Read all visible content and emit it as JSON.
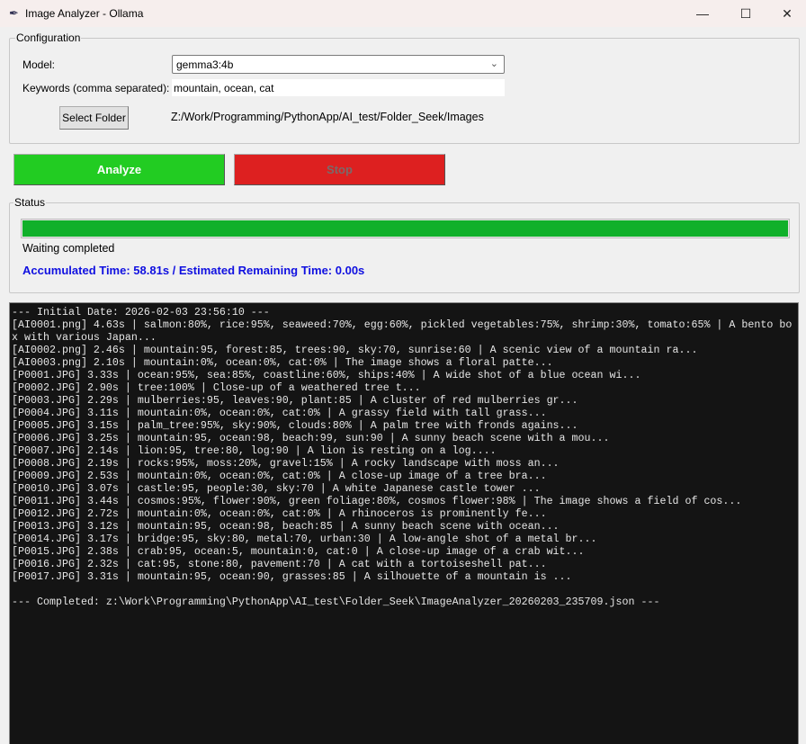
{
  "window": {
    "title": "Image Analyzer - Ollama",
    "minimize": "—",
    "maximize": "☐",
    "close": "✕"
  },
  "config": {
    "legend": "Configuration",
    "model_label": "Model:",
    "model_value": "gemma3:4b",
    "keywords_label": "Keywords (comma separated):",
    "keywords_value": "mountain, ocean, cat",
    "select_folder_label": "Select Folder",
    "folder_path": "Z:/Work/Programming/PythonApp/AI_test/Folder_Seek/Images"
  },
  "actions": {
    "analyze_label": "Analyze",
    "stop_label": "Stop"
  },
  "status": {
    "legend": "Status",
    "progress_percent": 100,
    "message": "Waiting completed",
    "time_text": "Accumulated Time: 58.81s / Estimated Remaining Time: 0.00s"
  },
  "colors": {
    "analyze": "#22cc22",
    "stop": "#dd2020",
    "progress": "#10b02a",
    "time_text": "#1010e0",
    "log_bg": "#141414"
  },
  "log": [
    "--- Initial Date: 2026-02-03 23:56:10 ---",
    "[AI0001.png] 4.63s | salmon:80%, rice:95%, seaweed:70%, egg:60%, pickled vegetables:75%, shrimp:30%, tomato:65% | A bento box with various Japan...",
    "[AI0002.png] 2.46s | mountain:95, forest:85, trees:90, sky:70, sunrise:60 | A scenic view of a mountain ra...",
    "[AI0003.png] 2.10s | mountain:0%, ocean:0%, cat:0% | The image shows a floral patte...",
    "[P0001.JPG] 3.33s | ocean:95%, sea:85%, coastline:60%, ships:40% | A wide shot of a blue ocean wi...",
    "[P0002.JPG] 2.90s | tree:100% | Close-up of a weathered tree t...",
    "[P0003.JPG] 2.29s | mulberries:95, leaves:90, plant:85 | A cluster of red mulberries gr...",
    "[P0004.JPG] 3.11s | mountain:0%, ocean:0%, cat:0% | A grassy field with tall grass...",
    "[P0005.JPG] 3.15s | palm_tree:95%, sky:90%, clouds:80% | A palm tree with fronds agains...",
    "[P0006.JPG] 3.25s | mountain:95, ocean:98, beach:99, sun:90 | A sunny beach scene with a mou...",
    "[P0007.JPG] 2.14s | lion:95, tree:80, log:90 | A lion is resting on a log....",
    "[P0008.JPG] 2.19s | rocks:95%, moss:20%, gravel:15% | A rocky landscape with moss an...",
    "[P0009.JPG] 2.53s | mountain:0%, ocean:0%, cat:0% | A close-up image of a tree bra...",
    "[P0010.JPG] 3.07s | castle:95, people:30, sky:70 | A white Japanese castle tower ...",
    "[P0011.JPG] 3.44s | cosmos:95%, flower:90%, green foliage:80%, cosmos flower:98% | The image shows a field of cos...",
    "[P0012.JPG] 2.72s | mountain:0%, ocean:0%, cat:0% | A rhinoceros is prominently fe...",
    "[P0013.JPG] 3.12s | mountain:95, ocean:98, beach:85 | A sunny beach scene with ocean...",
    "[P0014.JPG] 3.17s | bridge:95, sky:80, metal:70, urban:30 | A low-angle shot of a metal br...",
    "[P0015.JPG] 2.38s | crab:95, ocean:5, mountain:0, cat:0 | A close-up image of a crab wit...",
    "[P0016.JPG] 2.32s | cat:95, stone:80, pavement:70 | A cat with a tortoiseshell pat...",
    "[P0017.JPG] 3.31s | mountain:95, ocean:90, grasses:85 | A silhouette of a mountain is ...",
    "",
    "--- Completed: z:\\Work\\Programming\\PythonApp\\AI_test\\Folder_Seek\\ImageAnalyzer_20260203_235709.json ---"
  ]
}
